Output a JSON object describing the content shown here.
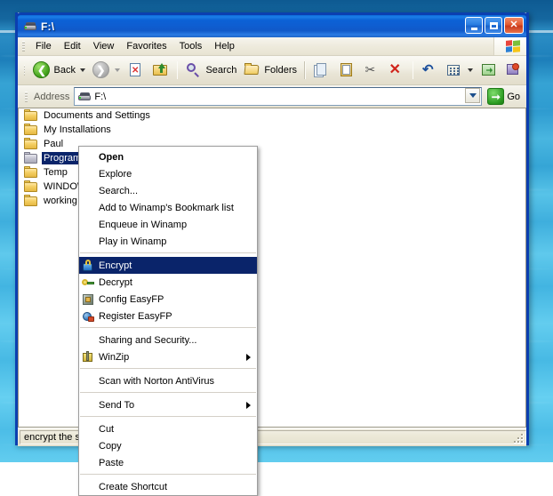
{
  "window": {
    "title": "F:\\",
    "title_icon": "drive-icon",
    "caption_buttons": {
      "minimize": "minimize-button",
      "maximize": "maximize-button",
      "close": "close-button"
    }
  },
  "menubar": {
    "items": [
      {
        "label": "File"
      },
      {
        "label": "Edit"
      },
      {
        "label": "View"
      },
      {
        "label": "Favorites"
      },
      {
        "label": "Tools"
      },
      {
        "label": "Help"
      }
    ],
    "brand_icon": "windows-flag-icon"
  },
  "toolbar": {
    "back_label": "Back",
    "search_label": "Search",
    "folders_label": "Folders",
    "icons": [
      "back-icon",
      "back-dropdown-icon",
      "forward-icon",
      "up-icon",
      "stop-icon",
      "up-one-level-icon",
      "search-icon",
      "folders-icon",
      "copy-icon",
      "paste-icon",
      "cut-icon",
      "delete-icon",
      "undo-icon",
      "views-icon",
      "views-dropdown-icon",
      "move-to-icon",
      "properties-icon"
    ]
  },
  "address": {
    "label": "Address",
    "value": "F:\\",
    "placeholder": "F:\\",
    "icon": "drive-icon",
    "dropdown_icon": "chevron-down-icon",
    "go_label": "Go",
    "go_icon": "go-arrow-icon"
  },
  "filelist": {
    "items": [
      {
        "name": "Documents and Settings",
        "icon": "folder-icon",
        "selected": false
      },
      {
        "name": "My Installations",
        "icon": "folder-icon",
        "selected": false
      },
      {
        "name": "Paul",
        "icon": "folder-icon",
        "selected": false
      },
      {
        "name": "Program Files",
        "icon": "folder-icon-gray",
        "selected": true
      },
      {
        "name": "Temp",
        "icon": "folder-icon",
        "selected": false
      },
      {
        "name": "WINDOWS",
        "icon": "folder-icon",
        "selected": false
      },
      {
        "name": "working",
        "icon": "folder-icon",
        "selected": false
      }
    ]
  },
  "statusbar": {
    "text": "encrypt the s"
  },
  "contextmenu": {
    "items": [
      {
        "label": "Open",
        "bold": true,
        "icon": null,
        "highlight": false,
        "submenu": false
      },
      {
        "label": "Explore",
        "bold": false,
        "icon": null,
        "highlight": false,
        "submenu": false
      },
      {
        "label": "Search...",
        "bold": false,
        "icon": null,
        "highlight": false,
        "submenu": false
      },
      {
        "label": "Add to Winamp's Bookmark list",
        "bold": false,
        "icon": null,
        "highlight": false,
        "submenu": false
      },
      {
        "label": "Enqueue in Winamp",
        "bold": false,
        "icon": null,
        "highlight": false,
        "submenu": false
      },
      {
        "label": "Play in Winamp",
        "bold": false,
        "icon": null,
        "highlight": false,
        "submenu": false
      },
      {
        "separator": true
      },
      {
        "label": "Encrypt",
        "bold": false,
        "icon": "lock-icon",
        "highlight": true,
        "submenu": false
      },
      {
        "label": "Decrypt",
        "bold": false,
        "icon": "key-icon",
        "highlight": false,
        "submenu": false
      },
      {
        "label": "Config EasyFP",
        "bold": false,
        "icon": "config-icon",
        "highlight": false,
        "submenu": false
      },
      {
        "label": "Register EasyFP",
        "bold": false,
        "icon": "register-icon",
        "highlight": false,
        "submenu": false
      },
      {
        "separator": true
      },
      {
        "label": "Sharing and Security...",
        "bold": false,
        "icon": null,
        "highlight": false,
        "submenu": false
      },
      {
        "label": "WinZip",
        "bold": false,
        "icon": "winzip-icon",
        "highlight": false,
        "submenu": true
      },
      {
        "separator": true
      },
      {
        "label": "Scan with Norton AntiVirus",
        "bold": false,
        "icon": null,
        "highlight": false,
        "submenu": false
      },
      {
        "separator": true
      },
      {
        "label": "Send To",
        "bold": false,
        "icon": null,
        "highlight": false,
        "submenu": true
      },
      {
        "separator": true
      },
      {
        "label": "Cut",
        "bold": false,
        "icon": null,
        "highlight": false,
        "submenu": false
      },
      {
        "label": "Copy",
        "bold": false,
        "icon": null,
        "highlight": false,
        "submenu": false
      },
      {
        "label": "Paste",
        "bold": false,
        "icon": null,
        "highlight": false,
        "submenu": false
      },
      {
        "separator": true
      },
      {
        "label": "Create Shortcut",
        "bold": false,
        "icon": null,
        "highlight": false,
        "submenu": false
      }
    ]
  },
  "colors": {
    "selection": "#0a246a",
    "titlebar": "#0b62d6",
    "window_border": "#0b3fb0",
    "desktop": "#4cbde7",
    "chrome": "#ece9d8"
  }
}
